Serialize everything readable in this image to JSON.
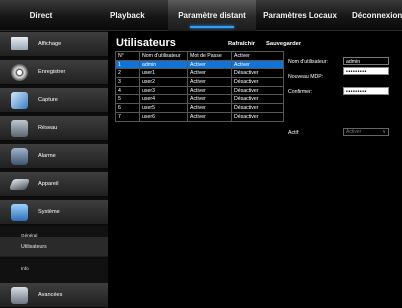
{
  "nav": {
    "tabs": [
      {
        "label": "Direct"
      },
      {
        "label": "Playback"
      },
      {
        "label": "Paramètre distant"
      },
      {
        "label": "Paramètres Locaux"
      },
      {
        "label": "Déconnexion"
      }
    ],
    "active": "Paramètre distant"
  },
  "sidebar": {
    "items": [
      {
        "label": "Affichage",
        "icon": "monitor-icon"
      },
      {
        "label": "Enregistrer",
        "icon": "film-reel-icon"
      },
      {
        "label": "Capture",
        "icon": "capture-icon"
      },
      {
        "label": "Réseau",
        "icon": "network-icon"
      },
      {
        "label": "Alarme",
        "icon": "alarm-icon"
      },
      {
        "label": "Appareil",
        "icon": "hard-drive-icon"
      },
      {
        "label": "Système",
        "icon": "system-icon"
      }
    ],
    "sub_items": [
      {
        "label": "Général"
      },
      {
        "label": "Utilisateurs"
      },
      {
        "label": "Info"
      },
      {
        "label": "Info Chaîne"
      },
      {
        "label": "Info Enregistrement"
      }
    ],
    "bottom_item": {
      "label": "Avancées",
      "icon": "advanced-icon"
    }
  },
  "main": {
    "title": "Utilisateurs",
    "refresh_label": "Rafraîchir",
    "save_label": "Sauvegarder",
    "table": {
      "headers": [
        "N°",
        "Nom d'utilisateur",
        "Mot de Passe",
        "Activer"
      ],
      "rows": [
        [
          "1",
          "admin",
          "Activer",
          "Activer"
        ],
        [
          "2",
          "user1",
          "Activer",
          "Désactiver"
        ],
        [
          "3",
          "user2",
          "Activer",
          "Désactiver"
        ],
        [
          "4",
          "user3",
          "Activer",
          "Désactiver"
        ],
        [
          "5",
          "user4",
          "Activer",
          "Désactiver"
        ],
        [
          "6",
          "user5",
          "Activer",
          "Désactiver"
        ],
        [
          "7",
          "user6",
          "Activer",
          "Désactiver"
        ]
      ],
      "selected_row": 0
    },
    "form": {
      "username_label": "Nom d'utilisateur:",
      "username_value": "admin",
      "new_password_label": "Nouveau MDP:",
      "new_password_value": "•••••••••",
      "confirm_label": "Confirmer:",
      "confirm_value": "•••••••••",
      "active_label": "Actif:",
      "active_value": "Activer"
    }
  },
  "colors": {
    "selection": "#1173d8",
    "accent": "#2fa0ff"
  }
}
